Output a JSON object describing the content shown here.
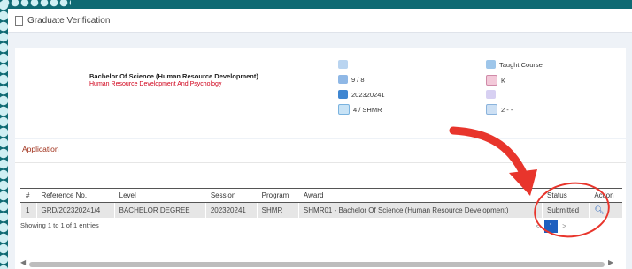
{
  "window": {
    "title": "Graduate Verification"
  },
  "program": {
    "title": "Bachelor Of Science (Human Resource Development)",
    "subtitle": "Human Resource Development And Psychology"
  },
  "info_col1": [
    {
      "icon": "id-card-icon",
      "text": ""
    },
    {
      "icon": "calendar-icon",
      "text": "9 / 8"
    },
    {
      "icon": "session-icon",
      "text": "202320241"
    },
    {
      "icon": "program-icon",
      "text": "4 / SHMR"
    }
  ],
  "info_col2": [
    {
      "icon": "book-icon",
      "text": "Taught Course"
    },
    {
      "icon": "user-icon",
      "text": "K"
    },
    {
      "icon": "badge-icon",
      "text": ""
    },
    {
      "icon": "building-icon",
      "text": "2 - -"
    }
  ],
  "application": {
    "title": "Application",
    "columns": [
      "#",
      "Reference No.",
      "Level",
      "Session",
      "Program",
      "Award",
      "Status",
      "Action"
    ],
    "rows": [
      [
        "1",
        "GRD/202320241/4",
        "BACHELOR DEGREE",
        "202320241",
        "SHMR",
        "SHMR01 - Bachelor Of Science (Human Resource Development)",
        "Submitted"
      ]
    ],
    "showing": "Showing 1 to 1 of 1 entries",
    "pager": {
      "prev": "<",
      "current": "1",
      "next": ">"
    }
  },
  "colors": {
    "accent": "#1e5fbf",
    "annotation": "#e8352c",
    "frame_bg": "#0f6a73"
  }
}
